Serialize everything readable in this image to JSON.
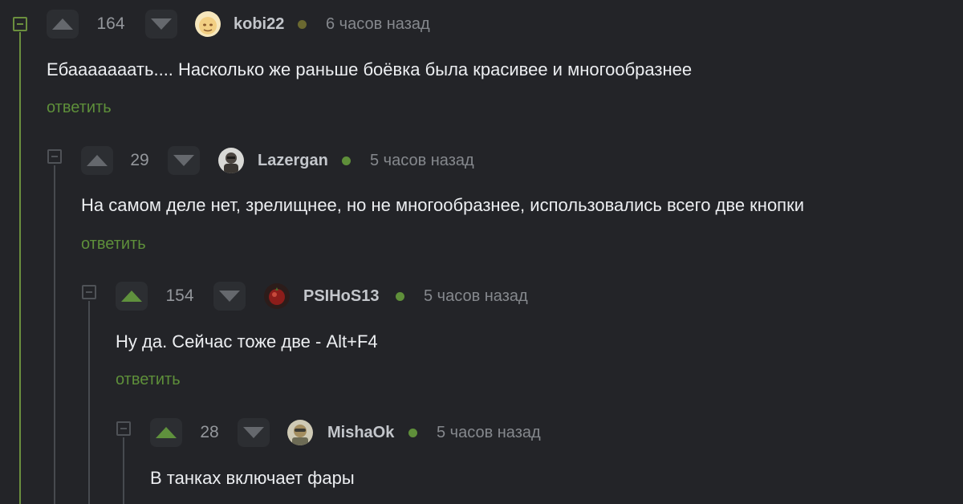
{
  "comments": [
    {
      "rating": "164",
      "username": "kobi22",
      "time": "6 часов назад",
      "text": "Ебааааааать.... Насколько же раньше боёвка была красивее и многообразнее",
      "reply_label": "ответить",
      "avatar_icon": "avatar-icon",
      "upvoted": false
    },
    {
      "rating": "29",
      "username": "Lazergan",
      "time": "5 часов назад",
      "text": "На самом деле нет, зрелищнее, но не многообразнее, использовались всего две кнопки",
      "reply_label": "ответить",
      "avatar_icon": "avatar-icon",
      "upvoted": false
    },
    {
      "rating": "154",
      "username": "PSIHoS13",
      "time": "5 часов назад",
      "text": "Ну да. Сейчас тоже две - Alt+F4",
      "reply_label": "ответить",
      "avatar_icon": "avatar-icon",
      "upvoted": true
    },
    {
      "rating": "28",
      "username": "MishaOk",
      "time": "5 часов назад",
      "text": "В танках включает фары",
      "avatar_icon": "avatar-icon",
      "upvoted": true
    }
  ],
  "colors": {
    "background": "#232428",
    "accent_green": "#5e8f3a",
    "text": "#eceef1",
    "muted": "#85888d"
  }
}
